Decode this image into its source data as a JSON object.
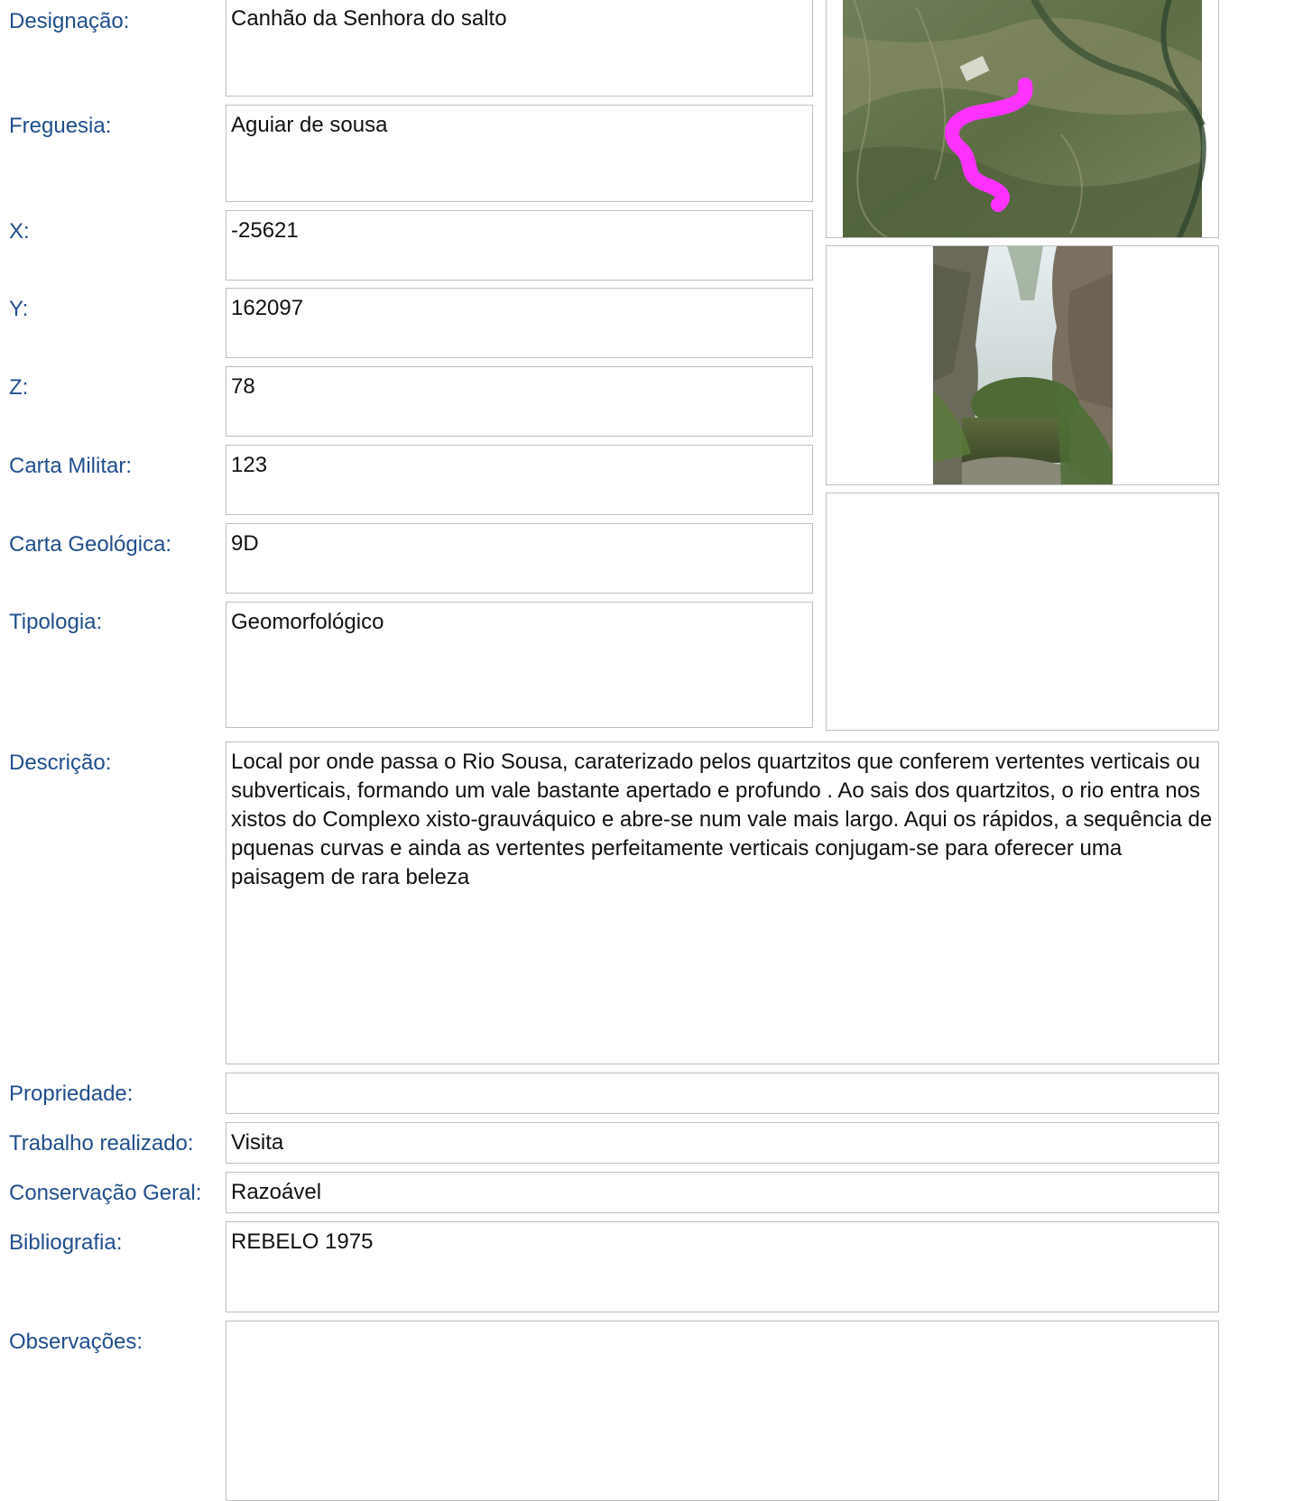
{
  "fields": {
    "designacao": {
      "label": "Designação:",
      "value": "Canhão da Senhora do salto"
    },
    "freguesia": {
      "label": "Freguesia:",
      "value": "Aguiar de sousa"
    },
    "x": {
      "label": "X:",
      "value": "-25621"
    },
    "y": {
      "label": "Y:",
      "value": "162097"
    },
    "z": {
      "label": "Z:",
      "value": "78"
    },
    "carta_militar": {
      "label": "Carta Militar:",
      "value": "123"
    },
    "carta_geologica": {
      "label": "Carta Geológica:",
      "value": "9D"
    },
    "tipologia": {
      "label": "Tipologia:",
      "value": "Geomorfológico"
    },
    "descricao": {
      "label": "Descrição:",
      "value": "Local por onde passa o Rio Sousa, caraterizado pelos quartzitos que conferem vertentes verticais ou subverticais, formando  um vale bastante apertado e profundo . Ao sais dos quartzitos, o rio entra nos xistos do Complexo xisto-grauváquico e abre-se num vale mais largo. Aqui os rápidos, a sequência de pquenas curvas e ainda as vertentes perfeitamente verticais conjugam-se para oferecer uma paisagem de rara beleza"
    },
    "propriedade": {
      "label": "Propriedade:",
      "value": ""
    },
    "trabalho": {
      "label": "Trabalho realizado:",
      "value": "Visita"
    },
    "conservacao": {
      "label": "Conservação Geral:",
      "value": "Razoável"
    },
    "bibliografia": {
      "label": "Bibliografia:",
      "value": "REBELO 1975"
    },
    "observacoes": {
      "label": "Observações:",
      "value": ""
    }
  },
  "images": {
    "map": {
      "icon": "aerial-map-image",
      "route_color": "#ff33ff"
    },
    "photo": {
      "icon": "canyon-photo-image"
    },
    "empty": {
      "icon": "empty-image-slot"
    }
  }
}
